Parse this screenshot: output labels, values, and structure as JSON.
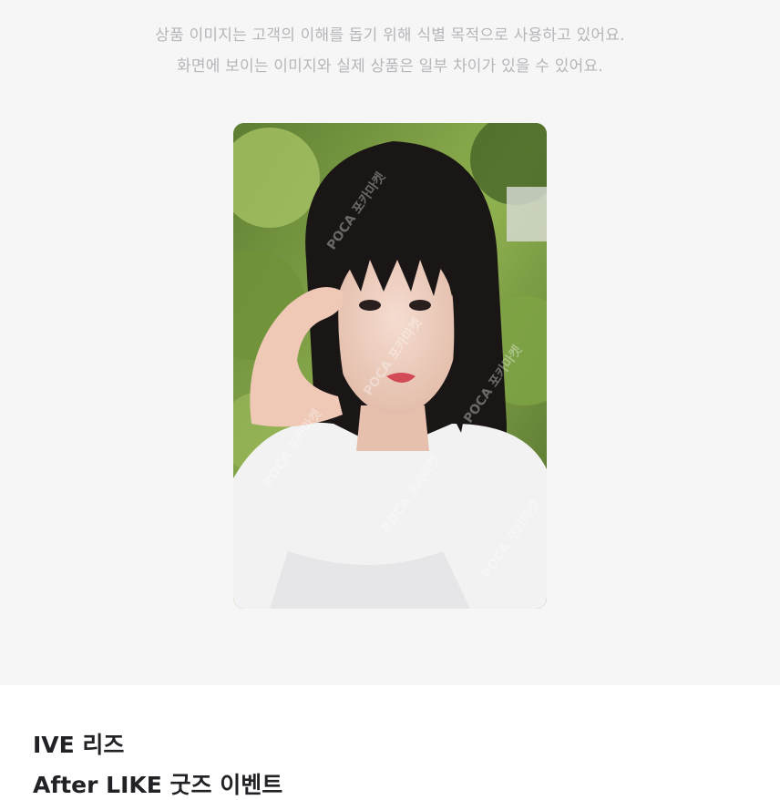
{
  "notice": {
    "line1": "상품 이미지는 고객의 이해를 돕기 위해 식별 목적으로 사용하고 있어요.",
    "line2": "화면에 보이는 이미지와 실제 상품은 일부 차이가 있을 수 있어요."
  },
  "photocard": {
    "watermark": "POCA 포카마켓"
  },
  "product": {
    "title": "IVE 리즈",
    "subtitle": "After LIKE 굿즈 이벤트"
  },
  "colors": {
    "preview_bg": "#f6f6f7",
    "notice_text": "#b6b6ba",
    "title_text": "#222226"
  }
}
